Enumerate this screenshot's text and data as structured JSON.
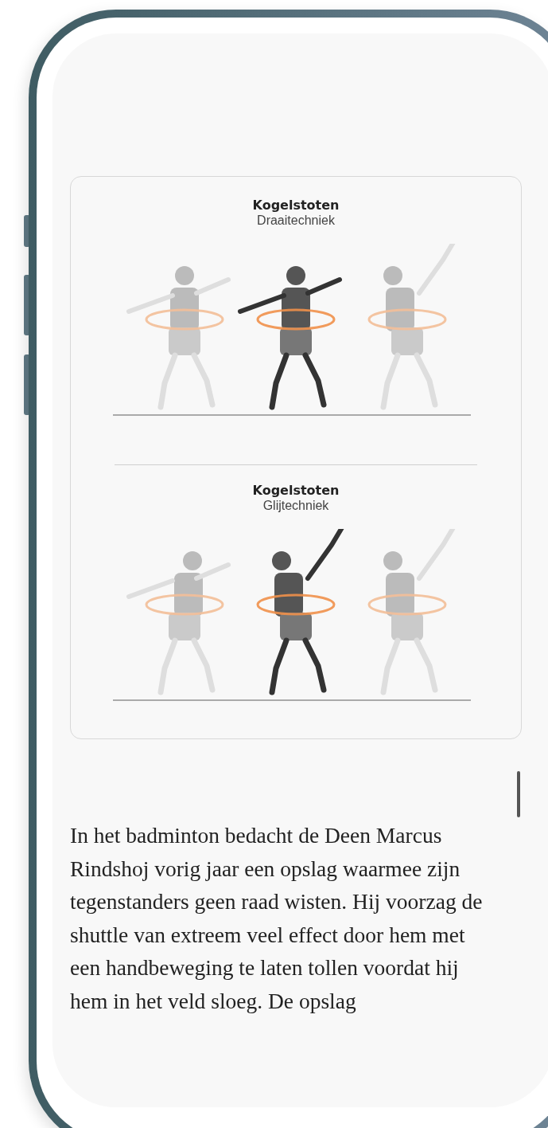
{
  "figures": [
    {
      "title": "Kogelstoten",
      "subtitle": "Draaitechniek"
    },
    {
      "title": "Kogelstoten",
      "subtitle": "Glijtechniek"
    }
  ],
  "paragraph": "In het badminton bedacht de Deen Marcus Rindshoj vorig jaar een opslag waarmee zijn tegenstanders geen raad wisten. Hij voorzag de shuttle van extreem veel effect door hem met een handbeweging te laten tollen voordat hij hem in het veld sloeg. De opslag"
}
